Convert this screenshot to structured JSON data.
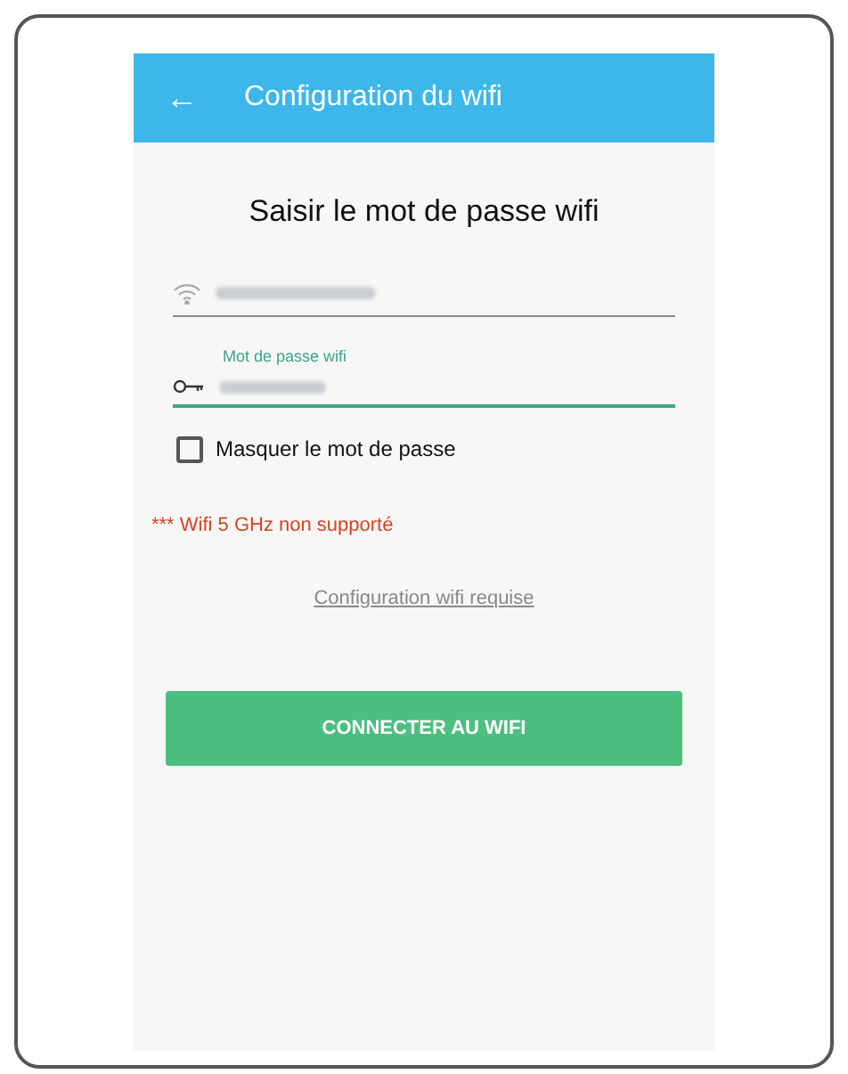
{
  "app_bar": {
    "back_icon": "←",
    "title": "Configuration du wifi"
  },
  "heading": "Saisir le mot de passe wifi",
  "network_field": {
    "blurred": true
  },
  "password_field": {
    "label": "Mot de passe wifi",
    "blurred": true,
    "focused": true
  },
  "hide_password": {
    "label": "Masquer le mot de passe",
    "checked": false
  },
  "warning": "*** Wifi 5 GHz non supporté",
  "link": "Configuration wifi requise",
  "connect_button": "CONNECTER AU WIFI"
}
